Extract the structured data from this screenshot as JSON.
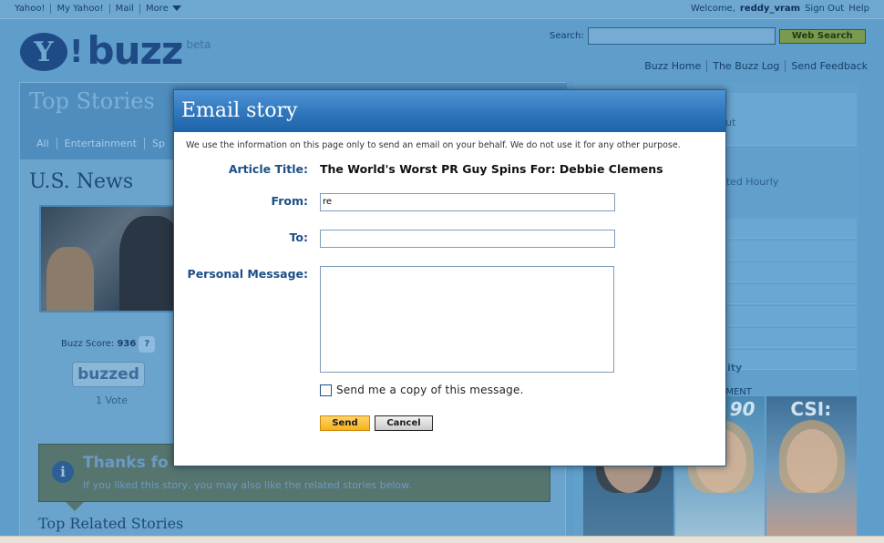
{
  "topbar": {
    "links": [
      "Yahoo!",
      "My Yahoo!",
      "Mail",
      "More"
    ],
    "welcome_prefix": "Welcome,",
    "username": "reddy_vram",
    "sign_out": "Sign Out",
    "help": "Help"
  },
  "logo": {
    "y": "Y",
    "exclaim": "!",
    "buzz": "buzz",
    "beta": "beta"
  },
  "search": {
    "label": "Search:",
    "button": "Web Search",
    "value": ""
  },
  "sub_links": [
    "Buzz Home",
    "The Buzz Log",
    "Send Feedback"
  ],
  "left": {
    "section_title": "Top Stories",
    "tabs": [
      "All",
      "Entertainment",
      "Sp"
    ],
    "news_title": "U.S. News",
    "buzz_score_label": "Buzz Score:",
    "buzz_score_value": "936",
    "help_q": "?",
    "buzzed": "buzzed",
    "votes": "1 Vote",
    "thanks_title": "Thanks fo",
    "thanks_text": "If you liked this story, you may also like the related stories below.",
    "info_glyph": "i",
    "related_title": "Top Related Stories"
  },
  "right": {
    "text_out": "ut",
    "text_hourly": "ated Hourly",
    "text_ity": "ity",
    "text_ement": "EMENT",
    "promo_csi": "CSI:",
    "promo_90": "90"
  },
  "modal": {
    "title": "Email story",
    "note": "We use the information on this page only to send an email on your behalf. We do not use it for any other purpose.",
    "article_label": "Article Title:",
    "article_value": "The World's Worst PR Guy Spins For: Debbie Clemens",
    "from_label": "From:",
    "from_value": "re",
    "to_label": "To:",
    "to_value": "",
    "message_label": "Personal Message:",
    "message_value": "",
    "copy_label": "Send me a copy of this message.",
    "copy_checked": false,
    "send": "Send",
    "cancel": "Cancel"
  },
  "colors": {
    "modal_header": "#2f76bd",
    "label_blue": "#1d4f86",
    "send_yellow": "#f7b21b",
    "overlay_blue": "#5b99c7"
  }
}
